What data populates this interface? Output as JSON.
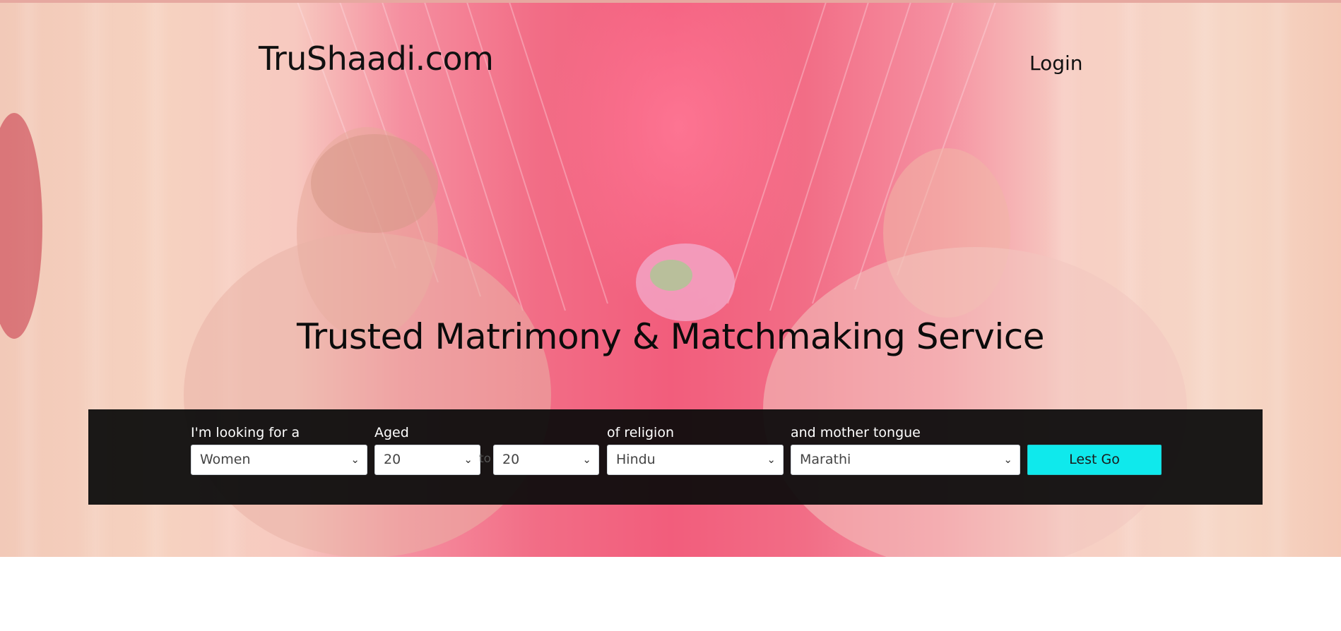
{
  "header": {
    "brand": "TruShaadi.com",
    "login_label": "Login"
  },
  "hero": {
    "headline": "Trusted Matrimony & Matchmaking Service"
  },
  "search": {
    "looking_for": {
      "label": "I'm looking for a",
      "value": "Women"
    },
    "aged": {
      "label": "Aged",
      "min_value": "20",
      "max_value": "20",
      "between_label": "to"
    },
    "religion": {
      "label": "of religion",
      "value": "Hindu"
    },
    "mother_tongue": {
      "label": "and mother tongue",
      "value": "Marathi"
    },
    "submit_label": "Lest Go"
  },
  "colors": {
    "accent": "#0fe9ec",
    "bar_background": "#0c0c0c"
  }
}
